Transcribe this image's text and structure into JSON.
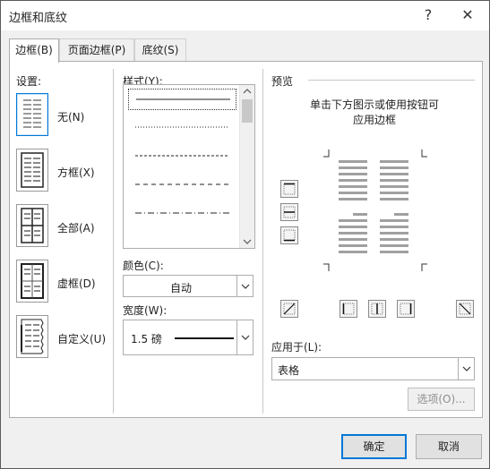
{
  "window": {
    "title": "边框和底纹",
    "help_glyph": "?",
    "close_glyph": "✕"
  },
  "tabs": [
    {
      "label": "边框(B)",
      "active": true
    },
    {
      "label": "页面边框(P)",
      "active": false
    },
    {
      "label": "底纹(S)",
      "active": false
    }
  ],
  "settings": {
    "heading": "设置:",
    "items": [
      {
        "label": "无(N)",
        "icon": "setting-none-icon",
        "selected": true
      },
      {
        "label": "方框(X)",
        "icon": "setting-box-icon",
        "selected": false
      },
      {
        "label": "全部(A)",
        "icon": "setting-all-icon",
        "selected": false
      },
      {
        "label": "虚框(D)",
        "icon": "setting-grid-icon",
        "selected": false
      },
      {
        "label": "自定义(U)",
        "icon": "setting-custom-icon",
        "selected": false
      }
    ]
  },
  "style": {
    "heading": "样式(Y):",
    "line_styles": [
      "solid",
      "dotted",
      "dashed-small",
      "dashed",
      "dash-dot"
    ],
    "selected_index": 0
  },
  "color": {
    "heading": "颜色(C):",
    "value": "自动"
  },
  "width": {
    "heading": "宽度(W):",
    "value": "1.5 磅"
  },
  "preview": {
    "heading": "预览",
    "instruction_line1": "单击下方图示或使用按钮可",
    "instruction_line2": "应用边框"
  },
  "apply_to": {
    "heading": "应用于(L):",
    "value": "表格"
  },
  "buttons": {
    "options": "选项(O)...",
    "ok": "确定",
    "cancel": "取消"
  },
  "colors": {
    "accent": "#0078d7",
    "panel_bg": "#ffffff",
    "dialog_bg": "#f0f0f0"
  }
}
